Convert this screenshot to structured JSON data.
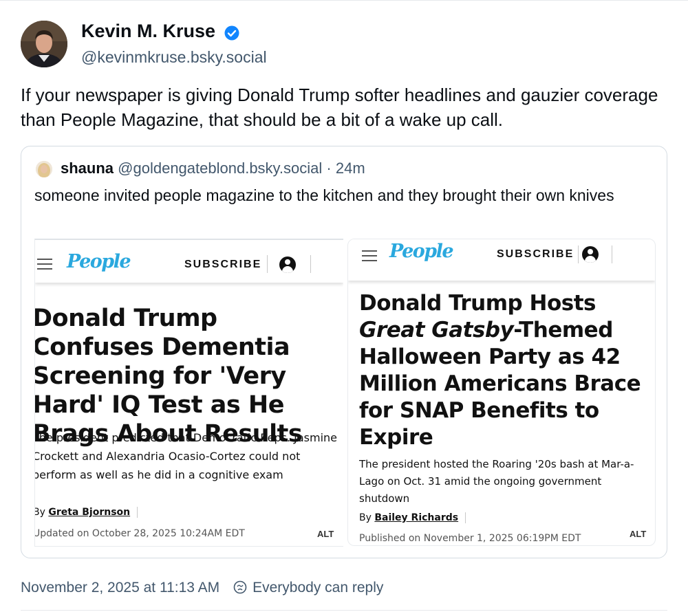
{
  "post": {
    "author_name": "Kevin M. Kruse",
    "author_handle": "@kevinmkruse.bsky.social",
    "text": "If your newspaper is giving Donald Trump softer headlines and gauzier coverage than People Magazine, that should be a bit of a wake up call.",
    "timestamp": "November 2, 2025 at 11:13 AM",
    "reply_setting": "Everybody can reply"
  },
  "quote": {
    "name": "shauna",
    "handle": "@goldengateblond.bsky.social",
    "time": "24m",
    "separator": "·",
    "text": "someone invited people magazine to the kitchen and they brought their own knives",
    "images": [
      {
        "logo": "People",
        "subscribe": "SUBSCRIBE",
        "headline": "Donald Trump Confuses Dementia Screening for 'Very Hard' IQ Test as He Brags About Results",
        "dek": "The president predicted that Democratic Reps. Jasmine Crockett and Alexandria Ocasio-Cortez could not perform as well as he did in a cognitive exam",
        "by": "By",
        "author": "Greta Bjornson",
        "date": "Updated on October 28, 2025 10:24AM EDT",
        "alt": "ALT"
      },
      {
        "logo": "People",
        "subscribe": "SUBSCRIBE",
        "headline_pre": "Donald Trump Hosts",
        "headline_italic": "Great Gatsby",
        "headline_post": "-Themed Halloween Party as 42 Million Americans Brace for SNAP Benefits to Expire",
        "dek": "The president hosted the Roaring '20s bash at Mar-a-Lago on Oct. 31 amid the ongoing government shutdown",
        "by": "By",
        "author": "Bailey Richards",
        "date": "Published on November 1, 2025 06:19PM EDT",
        "alt": "ALT"
      }
    ]
  },
  "colors": {
    "accent": "#1185fe",
    "people_blue": "#2aa8de",
    "muted": "#42576c"
  }
}
